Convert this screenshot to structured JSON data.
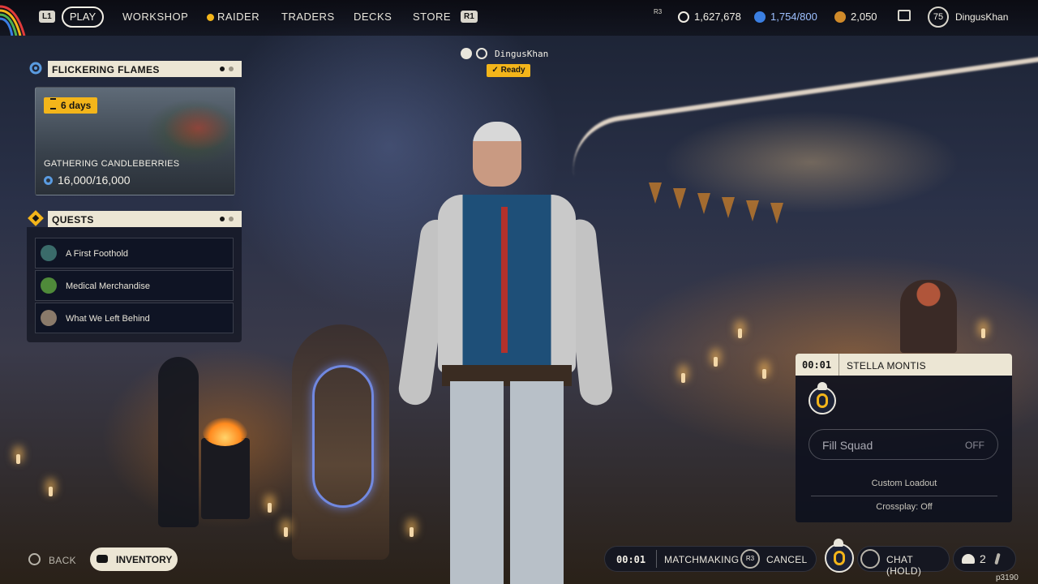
{
  "topbar": {
    "left_bumper": "L1",
    "right_bumper": "R1",
    "tabs": [
      {
        "label": "PLAY",
        "active": true
      },
      {
        "label": "WORKSHOP"
      },
      {
        "label": "RAIDER"
      },
      {
        "label": "TRADERS"
      },
      {
        "label": "DECKS"
      },
      {
        "label": "STORE"
      }
    ],
    "r3_hint": "R3",
    "currencies": [
      {
        "icon": "coins-icon",
        "value": "1,627,678"
      },
      {
        "icon": "raider-token-icon",
        "value": "1,754/800"
      },
      {
        "icon": "premium-currency-icon",
        "value": "2,050"
      }
    ],
    "player": {
      "level": "75",
      "name": "DingusKhan"
    }
  },
  "event": {
    "title": "FLICKERING FLAMES",
    "timer": "6  days",
    "name": "GATHERING CANDLEBERRIES",
    "progress": "16,000/16,000",
    "carousel_dots": 2,
    "active_dot": 0
  },
  "quests": {
    "title": "QUESTS",
    "items": [
      {
        "label": "A First Foothold",
        "color": "#3a6b6a"
      },
      {
        "label": "Medical Merchandise",
        "color": "#4f8a3a"
      },
      {
        "label": "What We Left Behind",
        "color": "#8a7a6a"
      }
    ]
  },
  "squad_member": {
    "name": "DingusKhan",
    "status": "Ready"
  },
  "lobby": {
    "timer": "00:01",
    "host": "STELLA MONTIS",
    "fill_squad_label": "Fill Squad",
    "fill_squad_value": "OFF",
    "custom_loadout": "Custom Loadout",
    "crossplay": "Crossplay: Off"
  },
  "bottom": {
    "back_label": "BACK",
    "inventory_label": "INVENTORY",
    "mm_timer": "00:01",
    "mm_label": "MATCHMAKING",
    "cancel_hint": "R3",
    "cancel_label": "CANCEL",
    "chat_label": "CHAT (HOLD)",
    "party_count": "2",
    "build_id": "p3190"
  },
  "colors": {
    "accent_yellow": "#f3b51a",
    "panel_cream": "#ece6d4",
    "panel_dark": "#0f1424"
  }
}
